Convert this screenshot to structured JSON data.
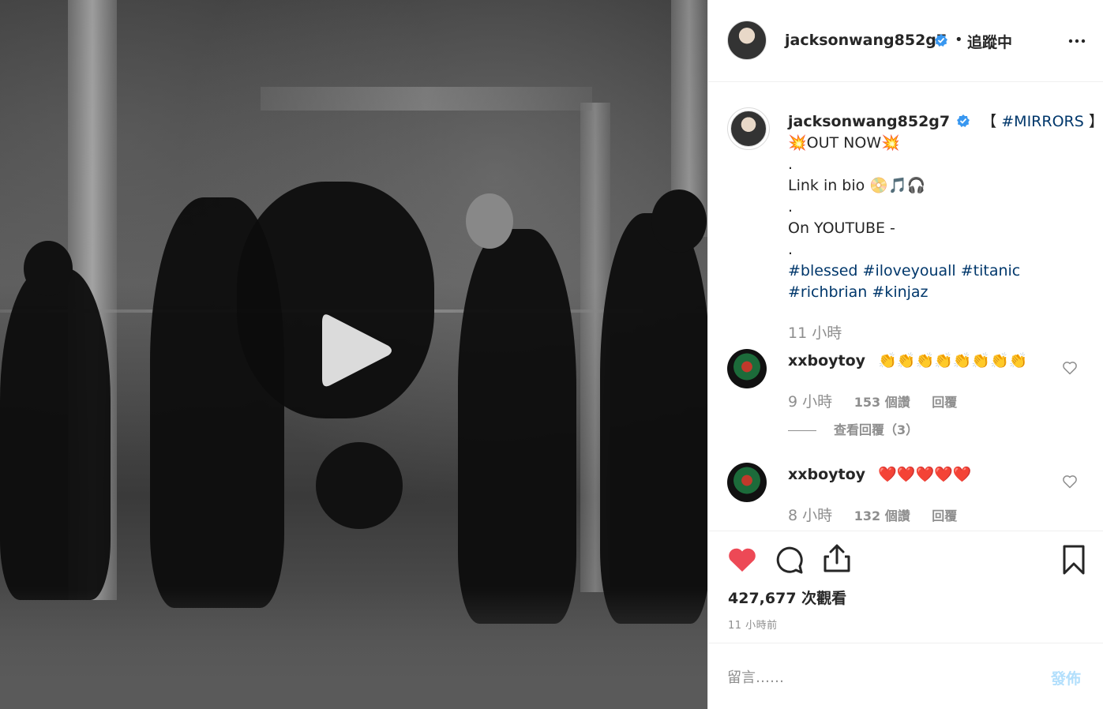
{
  "post": {
    "username": "jacksonwang852g7",
    "follow_separator": "•",
    "follow_label": "追蹤中"
  },
  "caption": {
    "line1_tag": "#MIRRORS",
    "line1_open": "【",
    "line1_close": "】",
    "line2": "💥OUT NOW💥",
    "dot1": ".",
    "line3": "Link in bio 📀🎵🎧",
    "dot2": ".",
    "line4": "On YOUTUBE -",
    "dot3": ".",
    "tags_row1": [
      "#blessed",
      "#iloveyouall",
      "#titanic"
    ],
    "tags_row2": [
      "#richbrian",
      "#kinjaz"
    ],
    "time": "11 小時"
  },
  "comments": [
    {
      "username": "xxboytoy",
      "text": "👏👏👏👏👏👏👏👏",
      "time": "9 小時",
      "likes": "153 個讚",
      "reply_label": "回覆",
      "view_replies": "查看回覆（3）"
    },
    {
      "username": "xxboytoy",
      "text": "❤️❤️❤️❤️❤️",
      "time": "8 小時",
      "likes": "132 個讚",
      "reply_label": "回覆"
    }
  ],
  "stats": {
    "views": "427,677 次觀看",
    "posted": "11 小時前"
  },
  "comment_box": {
    "placeholder": "留言……",
    "post_label": "發佈"
  },
  "colors": {
    "like_active": "#ed4956",
    "verified": "#3897f0",
    "link": "#00376b",
    "post_disabled": "#b2dffc"
  }
}
